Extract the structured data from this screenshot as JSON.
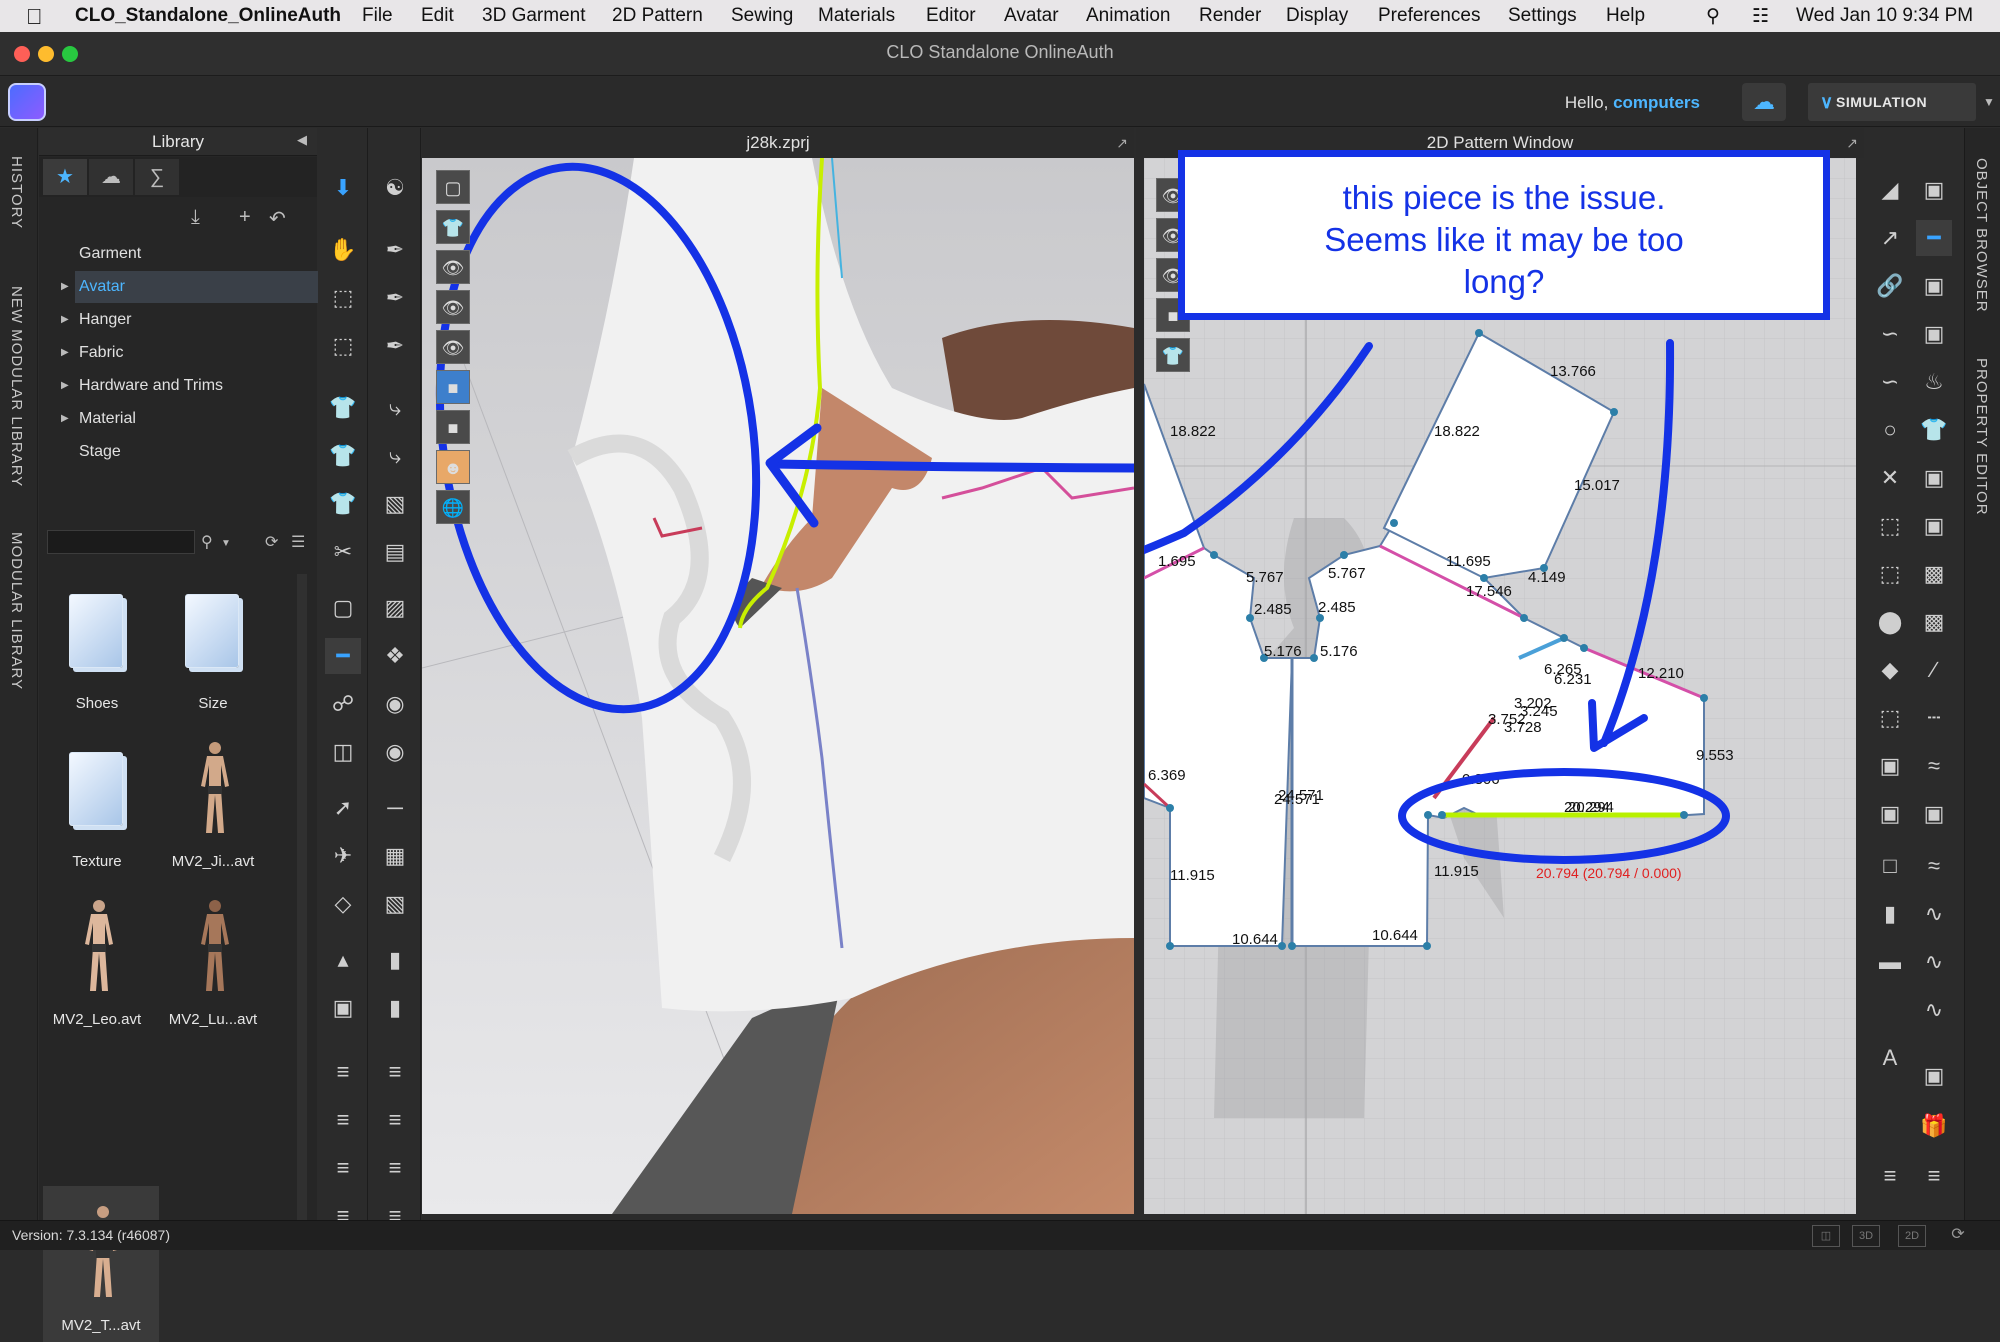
{
  "menubar": {
    "app_name": "CLO_Standalone_OnlineAuth",
    "items": [
      "File",
      "Edit",
      "3D Garment",
      "2D Pattern",
      "Sewing",
      "Materials",
      "Editor",
      "Avatar",
      "Animation",
      "Render",
      "Display",
      "Preferences",
      "Settings",
      "Help"
    ],
    "datetime": "Wed Jan 10  9:34 PM"
  },
  "window": {
    "title": "CLO Standalone OnlineAuth"
  },
  "appbar": {
    "hello": "Hello,",
    "user": "computers",
    "simulation_label": "SIMULATION"
  },
  "left_tabs": [
    "HISTORY",
    "NEW MODULAR LIBRARY",
    "MODULAR LIBRARY"
  ],
  "right_tabs": [
    "OBJECT BROWSER",
    "PROPERTY EDITOR"
  ],
  "library": {
    "title": "Library",
    "tree": [
      {
        "label": "Garment",
        "expandable": false
      },
      {
        "label": "Avatar",
        "expandable": true,
        "selected": true
      },
      {
        "label": "Hanger",
        "expandable": true
      },
      {
        "label": "Fabric",
        "expandable": true
      },
      {
        "label": "Hardware and Trims",
        "expandable": true
      },
      {
        "label": "Material",
        "expandable": true
      },
      {
        "label": "Stage",
        "expandable": false
      }
    ],
    "items": [
      {
        "label": "Shoes",
        "kind": "folder"
      },
      {
        "label": "Size",
        "kind": "folder"
      },
      {
        "label": "Texture",
        "kind": "folder"
      },
      {
        "label": "MV2_Ji...avt",
        "kind": "avatar"
      },
      {
        "label": "MV2_Leo.avt",
        "kind": "avatar"
      },
      {
        "label": "MV2_Lu...avt",
        "kind": "avatar"
      },
      {
        "label": "MV2_T...avt",
        "kind": "avatar",
        "selected": true
      }
    ]
  },
  "view3d": {
    "title": "j28k.zprj"
  },
  "view2d": {
    "title": "2D Pattern Window",
    "measurements": [
      "13.766",
      "18.822",
      "18.822",
      "15.017",
      "11.695",
      "1.695",
      "5.767",
      "5.767",
      "17.546",
      "4.149",
      "2.485",
      "2.485",
      "5.176",
      "5.176",
      "6.265",
      "6.231",
      "12.210",
      "3.202",
      "3.752",
      "3.728",
      "3.245",
      "9.553",
      "6.369",
      "24.571",
      "24.571",
      "0.806",
      "20.294",
      "20.294",
      "11.915",
      "11.915",
      "10.644",
      "10.644"
    ],
    "red_readout": "20.794 (20.794 / 0.000)"
  },
  "annotation": {
    "text": "this piece is the issue.\nSeems like it may be too\nlong?"
  },
  "status": {
    "version": "Version: 7.3.134 (r46087)",
    "view_buttons": [
      "2D",
      "3D"
    ]
  },
  "colors": {
    "accent": "#4db6ff",
    "annotation_blue": "#1432e6",
    "seam_green": "#b8f000",
    "seam_pink": "#d44fa8"
  }
}
